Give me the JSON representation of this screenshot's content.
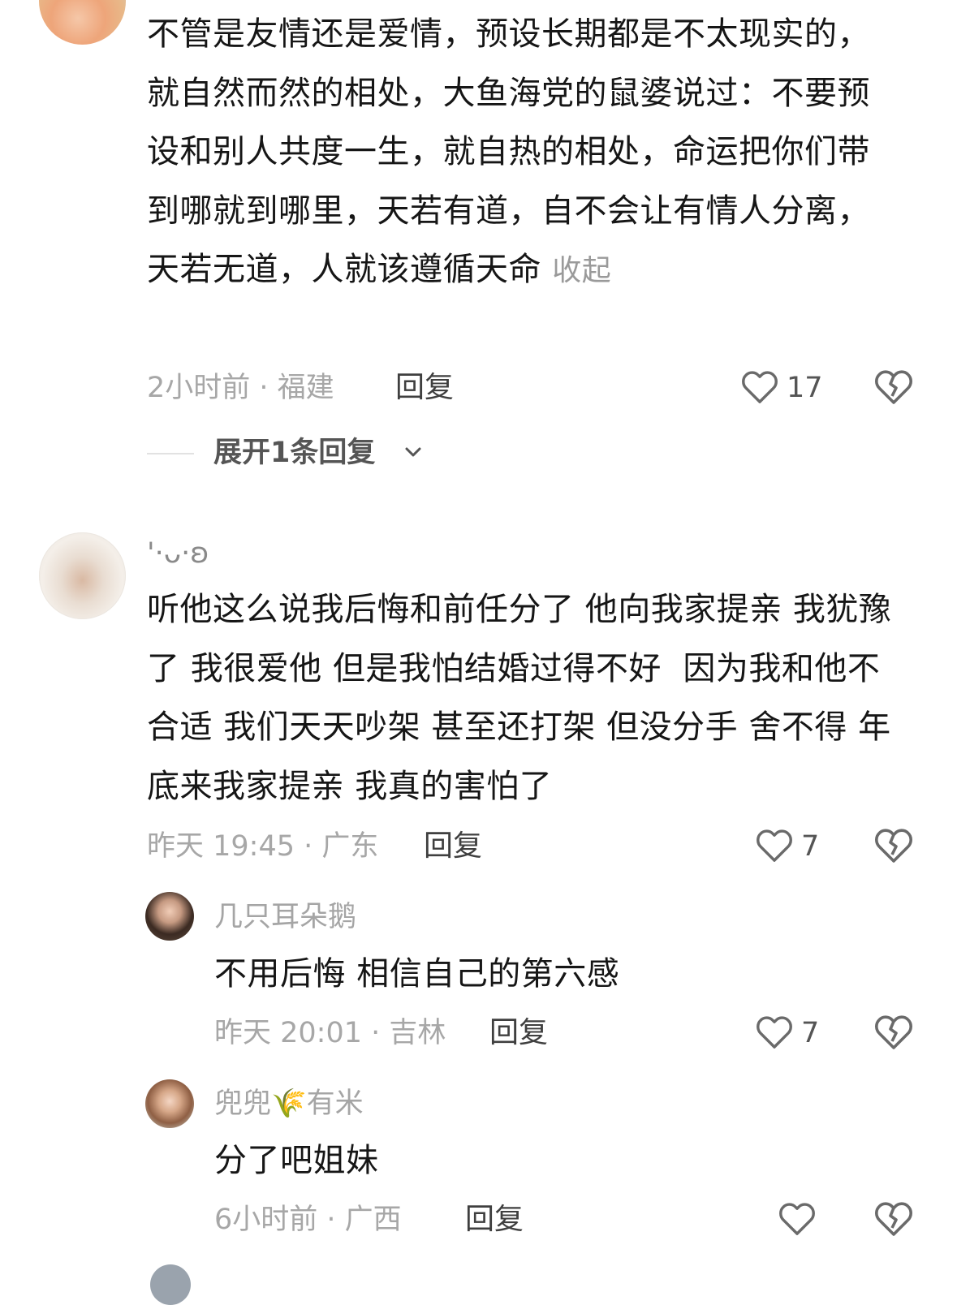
{
  "comments": [
    {
      "text": "不管是友情还是爱情，预设长期都是不太现实的，就自然而然的相处，大鱼海党的鼠婆说过：不要预设和别人共度一生，就自热的相处，命运把你们带到哪就到哪里，天若有道，自不会让有情人分离，天若无道，人就该遵循天命",
      "fold_label": "收起",
      "meta": "2小时前 · 福建",
      "reply_label": "回复",
      "likes": "17",
      "expand_label": "展开1条回复"
    },
    {
      "username": "'·ᴗ·ʚ",
      "text": "听他这么说我后悔和前任分了 他向我家提亲 我犹豫了 我很爱他 但是我怕结婚过得不好  因为我和他不合适 我们天天吵架 甚至还打架 但没分手 舍不得 年底来我家提亲 我真的害怕了",
      "meta": "昨天 19:45 · 广东",
      "reply_label": "回复",
      "likes": "7"
    }
  ],
  "replies": [
    {
      "username": "几只耳朵鹅",
      "text": "不用后悔 相信自己的第六感",
      "meta": "昨天 20:01 · 吉林",
      "reply_label": "回复",
      "likes": "7"
    },
    {
      "username": "兜兜🌾有米",
      "text": "分了吧姐妹",
      "meta": "6小时前 · 广西",
      "reply_label": "回复",
      "likes": ""
    }
  ],
  "icons": {
    "like": "heart-outline-icon",
    "dislike": "broken-heart-icon",
    "expand": "chevron-down-icon"
  },
  "colors": {
    "text": "#161616",
    "meta": "#a7a7a7",
    "icon": "#6a6a6a"
  }
}
